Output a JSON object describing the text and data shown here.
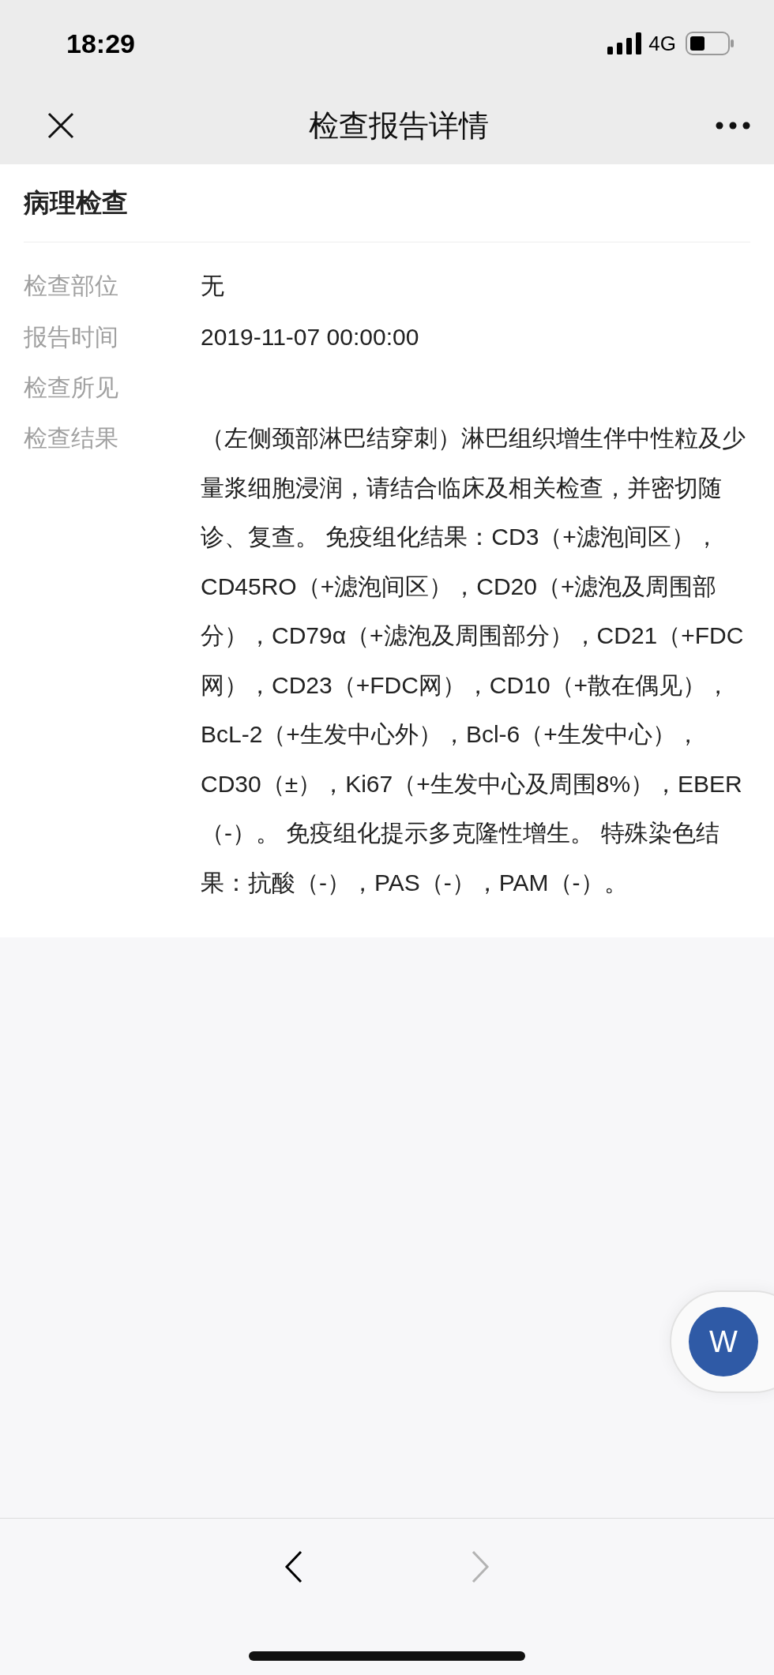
{
  "status_bar": {
    "time": "18:29",
    "network": "4G"
  },
  "nav_bar": {
    "title": "检查报告详情"
  },
  "section": {
    "title": "病理检查"
  },
  "fields": [
    {
      "label": "检查部位",
      "value": "无"
    },
    {
      "label": "报告时间",
      "value": "2019-11-07 00:00:00"
    },
    {
      "label": "检查所见"
    },
    {
      "label": "检查结果",
      "value": "（左侧颈部淋巴结穿刺）淋巴组织增生伴中性粒及少量浆细胞浸润，请结合临床及相关检查，并密切随诊、复查。 免疫组化结果：CD3（+滤泡间区），CD45RO（+滤泡间区），CD20（+滤泡及周围部分），CD79α（+滤泡及周围部分），CD21（+FDC网），CD23（+FDC网），CD10（+散在偶见），BcL-2（+生发中心外），Bcl-6（+生发中心），CD30（±），Ki67（+生发中心及周围8%），EBER（-）。 免疫组化提示多克隆性增生。 特殊染色结果：抗酸（-），PAS（-），PAM（-）。"
    }
  ],
  "floating_button": {
    "label": "W"
  },
  "toolbar": {
    "back": {
      "disabled": false
    },
    "forward": {
      "disabled": true
    }
  }
}
